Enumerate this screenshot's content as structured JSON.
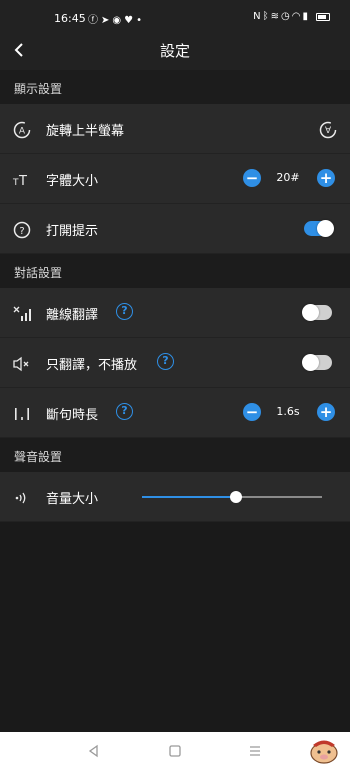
{
  "status_bar": {
    "time": "16:45",
    "left_icons": [
      "facebook-icon",
      "location-icon",
      "app-icon",
      "heart-icon",
      "dot-icon"
    ],
    "right_icons": [
      "nfc-icon",
      "bluetooth-icon",
      "vibrate-icon",
      "alarm-icon",
      "wifi-icon",
      "signal-icon",
      "battery-icon"
    ]
  },
  "header": {
    "title": "設定",
    "back": "back-icon"
  },
  "sections": {
    "display": {
      "title": "顯示設置"
    },
    "dialog": {
      "title": "對話設置"
    },
    "sound": {
      "title": "聲音設置"
    }
  },
  "rows": {
    "rotate": {
      "label": "旋轉上半螢幕"
    },
    "font_size": {
      "label": "字體大小",
      "value": "20#"
    },
    "tips": {
      "label": "打開提示",
      "enabled": true
    },
    "offline": {
      "label": "離線翻譯",
      "enabled": false
    },
    "translate_only": {
      "label": "只翻譯，不播放",
      "enabled": false
    },
    "pause": {
      "label": "斷句時長",
      "value": "1.6s"
    },
    "volume": {
      "label": "音量大小",
      "level": 0.52
    }
  },
  "colors": {
    "accent": "#2f8fe5",
    "background": "#1a1a1a",
    "row": "#2a2a2a"
  }
}
